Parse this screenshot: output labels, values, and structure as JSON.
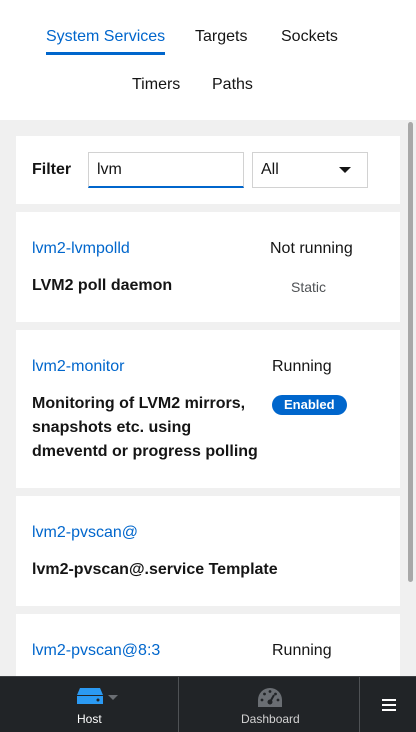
{
  "tabs": [
    {
      "label": "System Services",
      "active": true
    },
    {
      "label": "Targets",
      "active": false
    },
    {
      "label": "Sockets",
      "active": false
    },
    {
      "label": "Timers",
      "active": false
    },
    {
      "label": "Paths",
      "active": false
    }
  ],
  "filter": {
    "label": "Filter",
    "value": "lvm",
    "select_value": "All"
  },
  "services": [
    {
      "name": "lvm2-lvmpolld",
      "state": "Not running",
      "description": "LVM2 poll daemon",
      "enablement": "Static"
    },
    {
      "name": "lvm2-monitor",
      "state": "Running",
      "description": "Monitoring of LVM2 mirrors, snapshots etc. using dmeventd or progress polling",
      "enablement": "Enabled"
    },
    {
      "name": "lvm2-pvscan@",
      "state": "",
      "description": "lvm2-pvscan@.service Template",
      "enablement": ""
    },
    {
      "name": "lvm2-pvscan@8:3",
      "state": "Running",
      "description": "",
      "enablement": ""
    }
  ],
  "bottom_nav": {
    "host_label": "Host",
    "dashboard_label": "Dashboard",
    "host_icon": "server-icon",
    "dashboard_icon": "gauge-icon",
    "menu_icon": "hamburger-menu-icon"
  },
  "colors": {
    "accent": "#0066cc",
    "nav_background": "#212427",
    "page_background": "#f0f0f0"
  }
}
